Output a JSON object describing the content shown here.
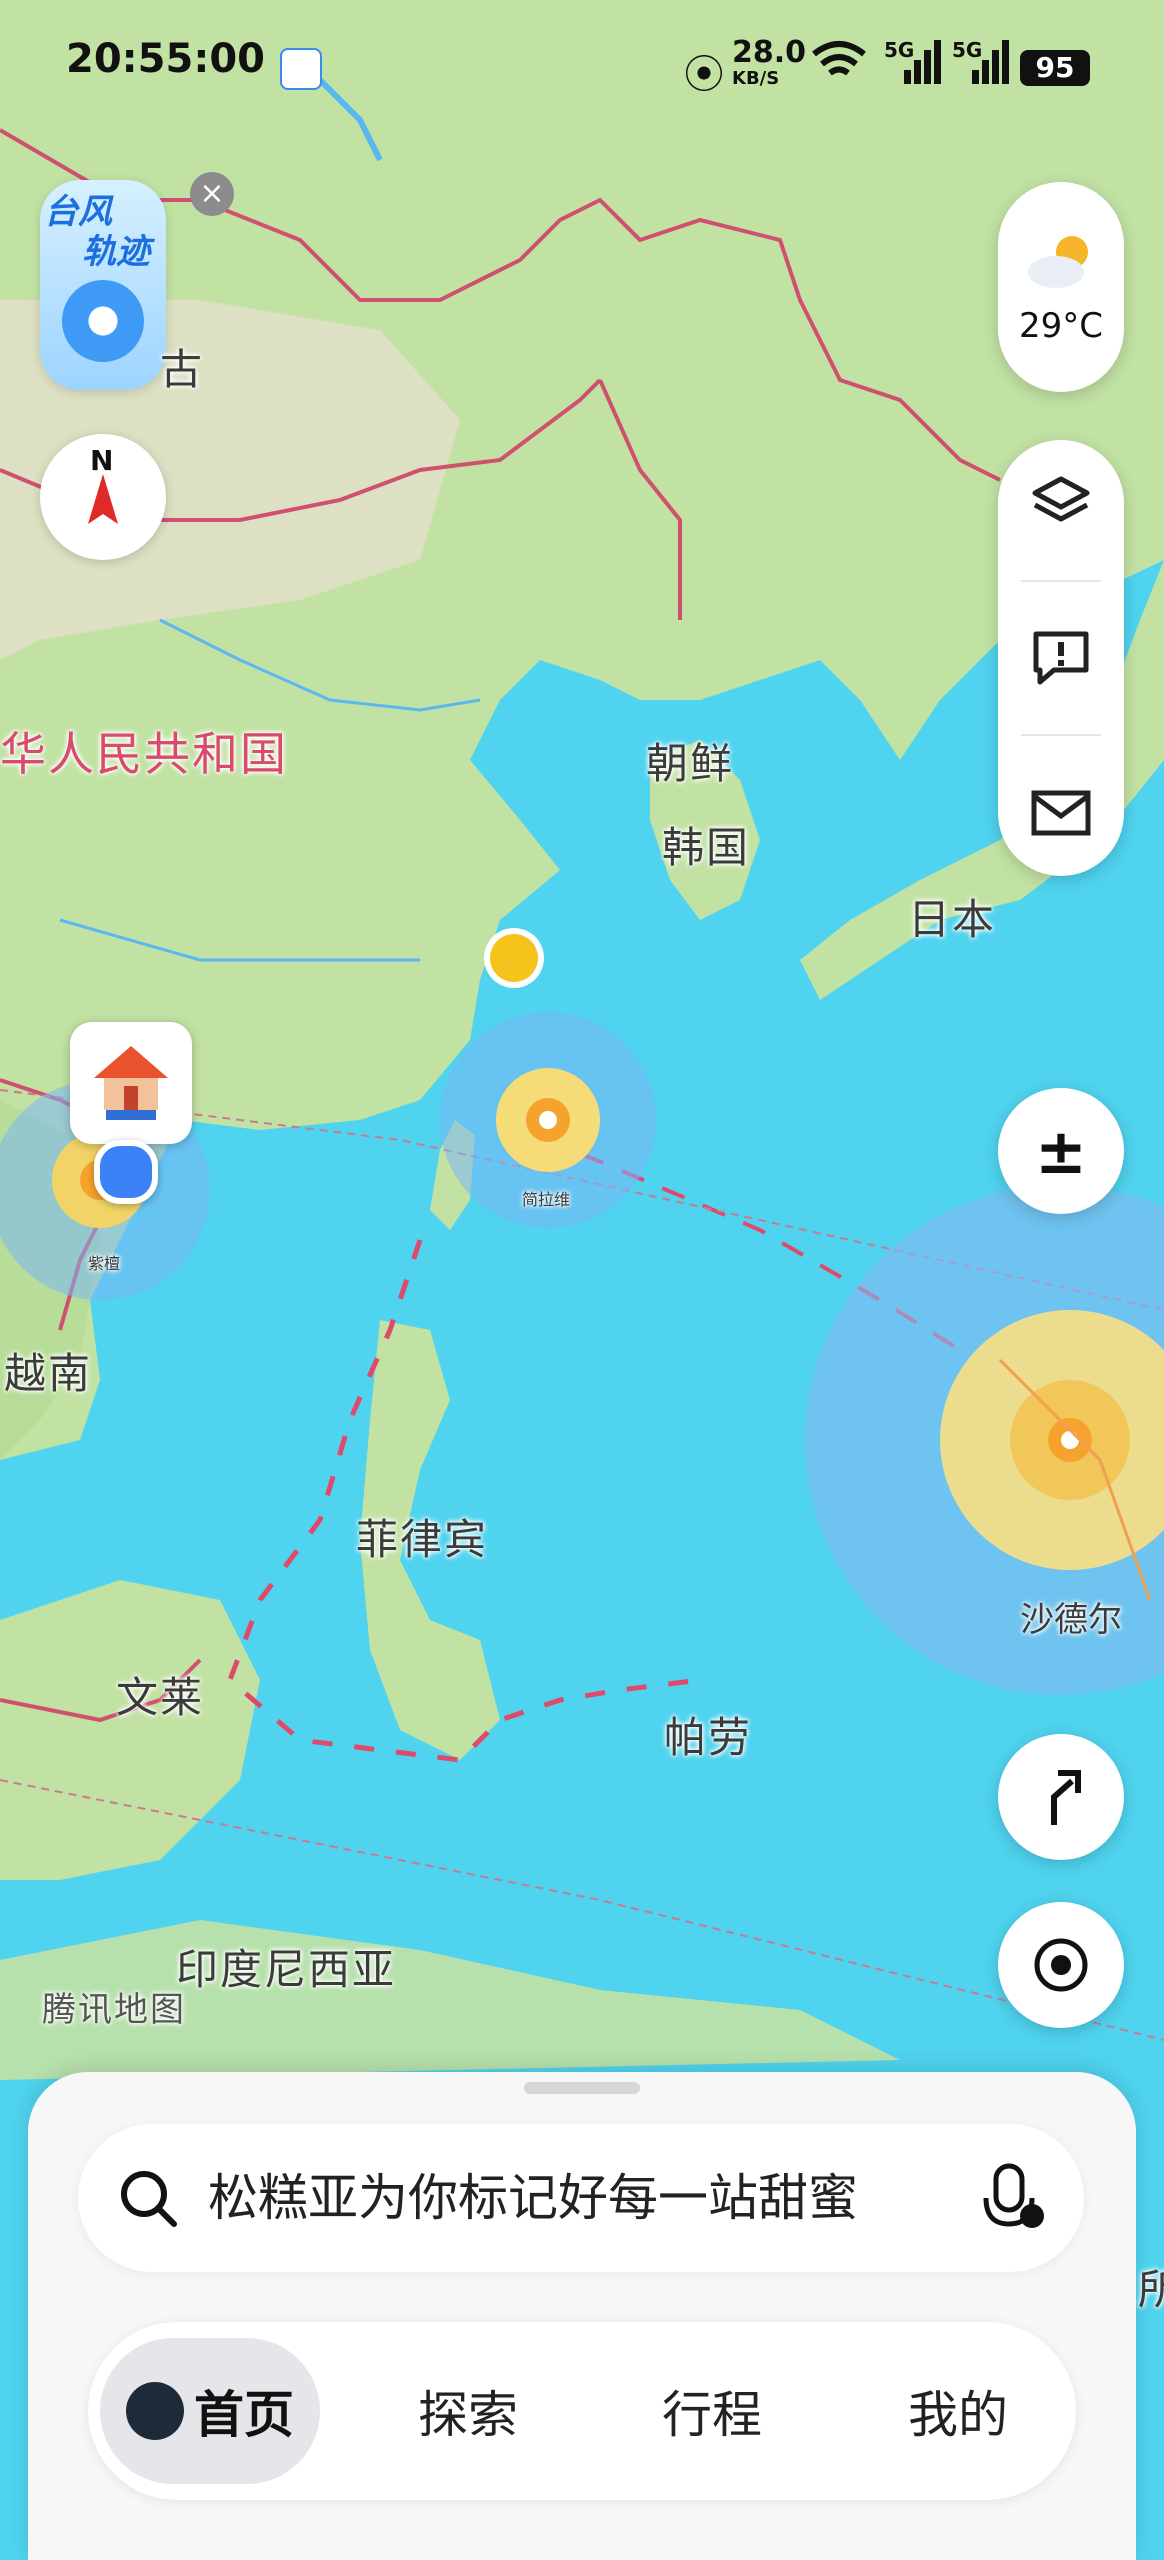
{
  "status_bar": {
    "time": "20:55:00",
    "speed_value": "28.0",
    "speed_unit": "KB/S",
    "network_1": "5G",
    "network_2": "5G",
    "wifi_sub": "6",
    "battery": "95"
  },
  "typhoon_badge": {
    "line1": "台风",
    "line2": "轨迹"
  },
  "weather": {
    "temp": "29°C"
  },
  "map_labels": {
    "mongolia_partial": "古",
    "china": "华人民共和国",
    "north_korea": "朝鲜",
    "south_korea": "韩国",
    "japan": "日本",
    "vietnam": "越南",
    "philippines": "菲律宾",
    "brunei": "文莱",
    "palau": "帕劳",
    "indonesia": "印度尼西亚",
    "edge_partial": "所"
  },
  "typhoons": {
    "wipha": "紫檀",
    "danas": "简拉维",
    "shaoder": "沙德尔"
  },
  "attribution": "腾讯地图",
  "search": {
    "placeholder": "松糕亚为你标记好每一站甜蜜"
  },
  "tabs": {
    "home": "首页",
    "explore": "探索",
    "trip": "行程",
    "mine": "我的"
  },
  "colors": {
    "sea": "#4fd3ee",
    "land": "#bfe3a0",
    "border": "#d05070",
    "accent": "#3a82f6"
  }
}
